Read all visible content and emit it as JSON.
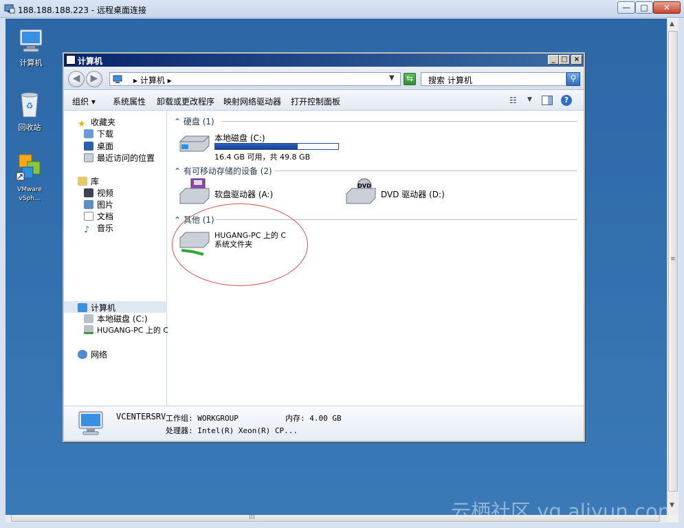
{
  "rdp": {
    "title": "188.188.188.223 - 远程桌面连接",
    "minimize": "—",
    "maximize": "□",
    "close": "✕"
  },
  "desktop_icons": [
    {
      "label": "计算机",
      "icon": "computer-icon"
    },
    {
      "label": "回收站",
      "icon": "recycle-bin-icon"
    },
    {
      "label": "VMware vSph...",
      "icon": "vmware-vsphere-icon"
    }
  ],
  "explorer": {
    "title": "计算机",
    "back": "◀",
    "forward": "▶",
    "address": "▸ 计算机 ▸",
    "search_placeholder": "搜索 计算机",
    "toolbar": {
      "organize": "组织 ▾",
      "system_properties": "系统属性",
      "uninstall": "卸载或更改程序",
      "map_drive": "映射网络驱动器",
      "control_panel": "打开控制面板"
    },
    "nav": {
      "favorites": "收藏夹",
      "downloads": "下载",
      "desktop": "桌面",
      "recent": "最近访问的位置",
      "libraries": "库",
      "videos": "视频",
      "pictures": "图片",
      "documents": "文档",
      "music": "音乐",
      "computer": "计算机",
      "local_disk": "本地磁盘 (C:)",
      "remote_share": "HUGANG-PC 上的 C",
      "network": "网络"
    },
    "groups": {
      "hard_disks": "硬盘 (1)",
      "removable": "有可移动存储的设备 (2)",
      "other": "其他 (1)"
    },
    "drives": {
      "c_name": "本地磁盘 (C:)",
      "c_space": "16.4 GB 可用，共 49.8 GB",
      "c_used_fraction": 0.67,
      "floppy": "软盘驱动器 (A:)",
      "dvd": "DVD 驱动器 (D:)",
      "share_name": "HUGANG-PC 上的 C",
      "share_type": "系统文件夹"
    },
    "details": {
      "computer_name": "VCENTERSRV",
      "workgroup": "工作组: WORKGROUP",
      "memory": "内存: 4.00 GB",
      "processor": "处理器: Intel(R) Xeon(R) CP..."
    }
  },
  "watermark": "云栖社区 yq.aliyun.com",
  "colors": {
    "desktop": "#2f6ead",
    "titlebar": "#0a246a",
    "annotation": "#d9534f"
  }
}
